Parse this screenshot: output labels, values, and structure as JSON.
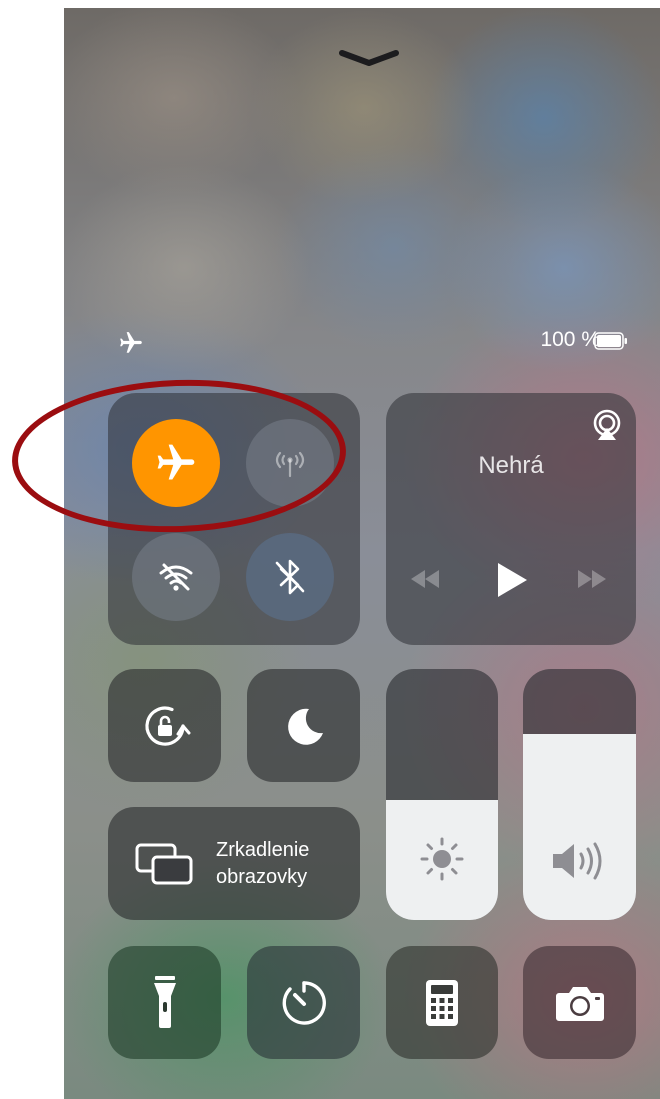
{
  "status_bar": {
    "battery_percent": "100 %",
    "battery_level": 1.0,
    "airplane_status_icon": "airplane-icon"
  },
  "connectivity": {
    "airplane_mode": {
      "icon": "airplane-icon",
      "on": true,
      "color": "#ff9500"
    },
    "cellular_data": {
      "icon": "antenna-icon",
      "on": false
    },
    "wifi": {
      "icon": "wifi-off-icon",
      "on": false
    },
    "bluetooth": {
      "icon": "bluetooth-off-icon",
      "on": false
    }
  },
  "music": {
    "status": "Nehrá",
    "airplay_icon": "airplay-icon",
    "controls": [
      "rewind-icon",
      "play-icon",
      "fast-forward-icon"
    ]
  },
  "controls": {
    "orientation_lock_icon": "orientation-lock-icon",
    "do_not_disturb_icon": "moon-icon",
    "screen_mirroring": {
      "icon": "screen-mirroring-icon",
      "line1": "Zrkadlenie",
      "line2": "obrazovky"
    }
  },
  "sliders": {
    "brightness": {
      "icon": "sun-icon",
      "level": 0.48
    },
    "volume": {
      "icon": "speaker-icon",
      "level": 0.74
    }
  },
  "shortcuts": [
    "flashlight-icon",
    "timer-icon",
    "calculator-icon",
    "camera-icon"
  ],
  "annotation": {
    "color": "#9b0d10"
  }
}
